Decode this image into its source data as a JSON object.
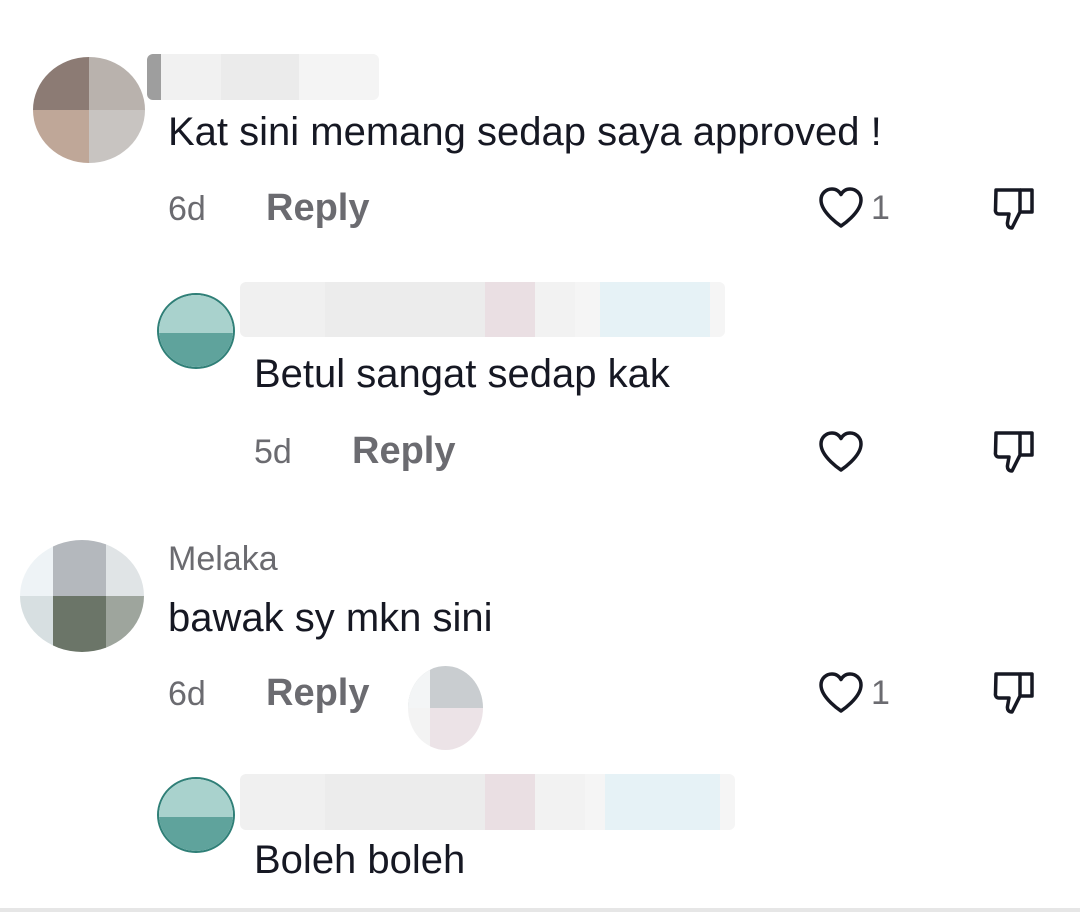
{
  "comments": [
    {
      "text": "Kat sini memang sedap saya approved !",
      "time": "6d",
      "reply_label": "Reply",
      "like_count": "1",
      "replies": [
        {
          "text": "Betul sangat sedap kak",
          "time": "5d",
          "reply_label": "Reply"
        }
      ]
    },
    {
      "username": "Melaka",
      "text": "bawak sy mkn sini",
      "time": "6d",
      "reply_label": "Reply",
      "like_count": "1",
      "replies": [
        {
          "text": "Boleh boleh"
        }
      ]
    }
  ],
  "icons": {
    "like": "heart-outline-icon",
    "dislike": "thumbs-down-icon"
  },
  "colors": {
    "text": "#161823",
    "secondary": "#6b6b70",
    "avatar_teal": "#5fa39c"
  }
}
